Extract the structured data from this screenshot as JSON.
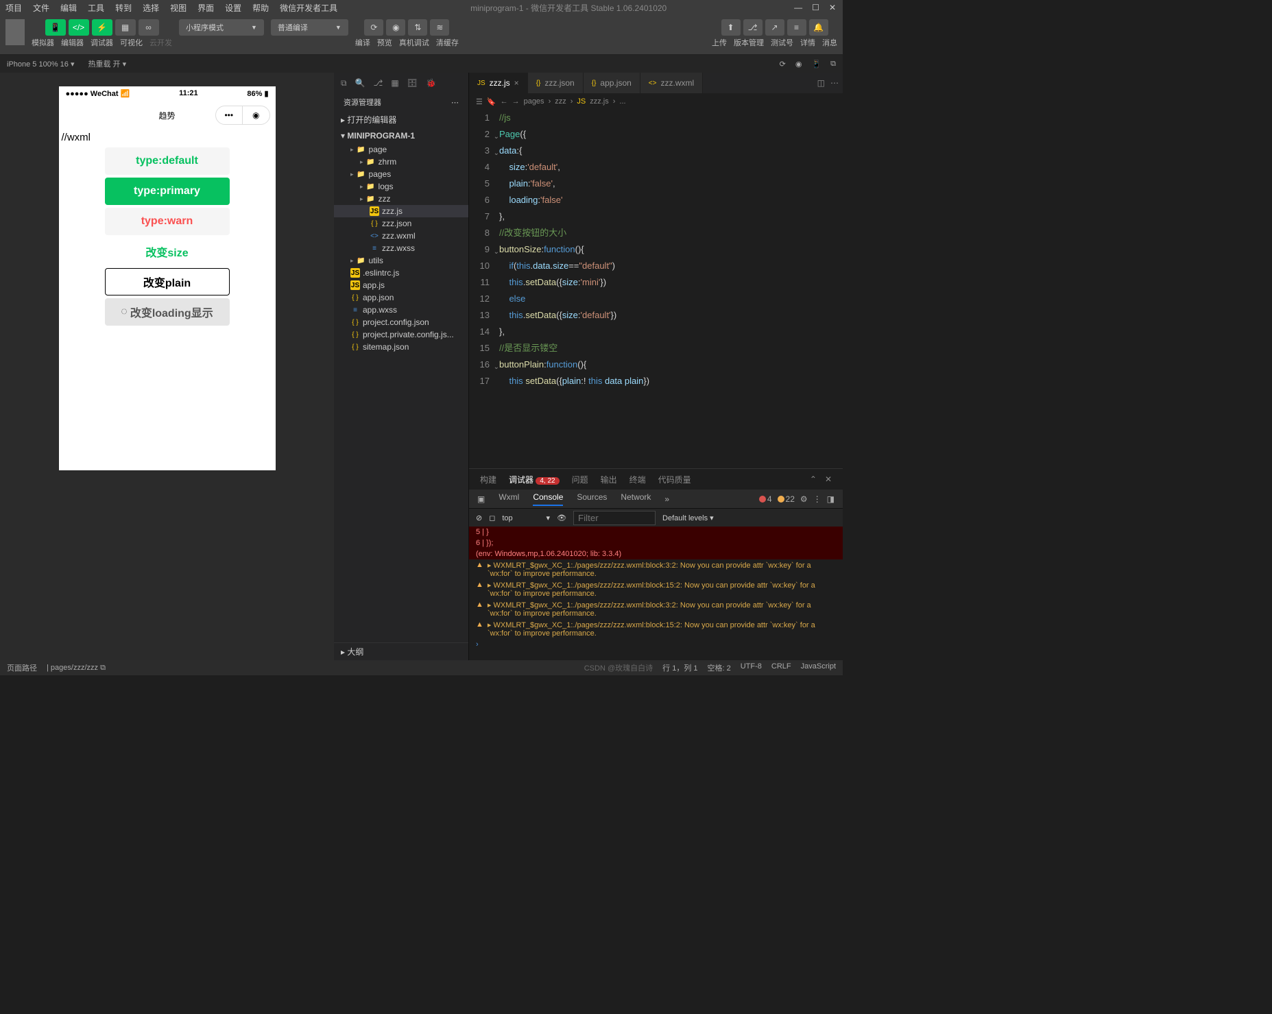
{
  "titlebar": {
    "menus": [
      "项目",
      "文件",
      "编辑",
      "工具",
      "转到",
      "选择",
      "视图",
      "界面",
      "设置",
      "帮助",
      "微信开发者工具"
    ],
    "title": "miniprogram-1 - 微信开发者工具 Stable 1.06.2401020"
  },
  "toolbar": {
    "groups": [
      {
        "labels": [
          "模拟器",
          "编辑器",
          "调试器",
          "可视化"
        ],
        "cloud": "云开发"
      }
    ],
    "mode": "小程序模式",
    "compile": "普通编译",
    "actions": [
      "编译",
      "预览",
      "真机调试",
      "清缓存"
    ],
    "right": [
      "上传",
      "版本管理",
      "测试号",
      "详情",
      "消息"
    ]
  },
  "subbar": {
    "device": "iPhone 5 100% 16",
    "hot": "热重载 开"
  },
  "phone": {
    "carrier": "●●●●● WeChat",
    "wifi": "📶",
    "time": "11:21",
    "battery": "86%",
    "title": "趋势",
    "wxml": "//wxml",
    "buttons": [
      "type:default",
      "type:primary",
      "type:warn",
      "改变size",
      "改变plain",
      "改变loading显示"
    ]
  },
  "explorer": {
    "title": "资源管理器",
    "sections": {
      "open": "打开的编辑器",
      "project": "MINIPROGRAM-1",
      "outline": "大纲"
    },
    "tree": [
      {
        "d": 1,
        "t": "folder",
        "n": "page"
      },
      {
        "d": 2,
        "t": "folder",
        "n": "zhrm"
      },
      {
        "d": 1,
        "t": "folder",
        "n": "pages"
      },
      {
        "d": 2,
        "t": "folder",
        "n": "logs"
      },
      {
        "d": 2,
        "t": "folder",
        "n": "zzz"
      },
      {
        "d": 3,
        "t": "js",
        "n": "zzz.js",
        "sel": true
      },
      {
        "d": 3,
        "t": "json",
        "n": "zzz.json"
      },
      {
        "d": 3,
        "t": "wxml",
        "n": "zzz.wxml"
      },
      {
        "d": 3,
        "t": "wxss",
        "n": "zzz.wxss"
      },
      {
        "d": 1,
        "t": "folder",
        "n": "utils"
      },
      {
        "d": 1,
        "t": "js",
        "n": ".eslintrc.js"
      },
      {
        "d": 1,
        "t": "js",
        "n": "app.js"
      },
      {
        "d": 1,
        "t": "json",
        "n": "app.json"
      },
      {
        "d": 1,
        "t": "wxss",
        "n": "app.wxss"
      },
      {
        "d": 1,
        "t": "json",
        "n": "project.config.json"
      },
      {
        "d": 1,
        "t": "json",
        "n": "project.private.config.js..."
      },
      {
        "d": 1,
        "t": "json",
        "n": "sitemap.json"
      }
    ]
  },
  "tabs": [
    {
      "icon": "JS",
      "name": "zzz.js",
      "active": true,
      "close": true
    },
    {
      "icon": "{}",
      "name": "zzz.json"
    },
    {
      "icon": "{}",
      "name": "app.json"
    },
    {
      "icon": "<>",
      "name": "zzz.wxml"
    }
  ],
  "breadcrumb": [
    "pages",
    "zzz",
    "zzz.js",
    "..."
  ],
  "code": {
    "lines": [
      {
        "n": 1,
        "seg": [
          [
            "c-comment",
            "//js"
          ]
        ]
      },
      {
        "n": 2,
        "fold": true,
        "seg": [
          [
            "c-page",
            "Page"
          ],
          [
            "c-punc",
            "("
          ],
          [
            "c-punc",
            "{"
          ]
        ]
      },
      {
        "n": 3,
        "fold": true,
        "seg": [
          [
            "c-prop",
            "data"
          ],
          [
            "c-punc",
            ":"
          ],
          [
            "c-punc",
            "{"
          ]
        ]
      },
      {
        "n": 4,
        "seg": [
          [
            "",
            "    "
          ],
          [
            "c-prop",
            "size"
          ],
          [
            "c-punc",
            ":"
          ],
          [
            "c-str",
            "'default'"
          ],
          [
            "c-punc",
            ","
          ]
        ]
      },
      {
        "n": 5,
        "seg": [
          [
            "",
            "    "
          ],
          [
            "c-prop",
            "plain"
          ],
          [
            "c-punc",
            ":"
          ],
          [
            "c-str",
            "'false'"
          ],
          [
            "c-punc",
            ","
          ]
        ]
      },
      {
        "n": 6,
        "seg": [
          [
            "",
            "    "
          ],
          [
            "c-prop",
            "loading"
          ],
          [
            "c-punc",
            ":"
          ],
          [
            "c-str",
            "'false'"
          ]
        ]
      },
      {
        "n": 7,
        "seg": [
          [
            "c-punc",
            "},"
          ]
        ]
      },
      {
        "n": 8,
        "seg": [
          [
            "c-comment",
            "//改变按钮的大小"
          ]
        ]
      },
      {
        "n": 9,
        "fold": true,
        "seg": [
          [
            "c-fn",
            "buttonSize"
          ],
          [
            "c-punc",
            ":"
          ],
          [
            "c-kw",
            "function"
          ],
          [
            "c-punc",
            "(){"
          ]
        ]
      },
      {
        "n": 10,
        "seg": [
          [
            "",
            "    "
          ],
          [
            "c-kw",
            "if"
          ],
          [
            "c-punc",
            "("
          ],
          [
            "c-this",
            "this"
          ],
          [
            "c-punc",
            "."
          ],
          [
            "c-prop",
            "data"
          ],
          [
            "c-punc",
            "."
          ],
          [
            "c-prop",
            "size"
          ],
          [
            "c-punc",
            "=="
          ],
          [
            "c-str",
            "\"default\""
          ],
          [
            "c-punc",
            ")"
          ]
        ]
      },
      {
        "n": 11,
        "seg": [
          [
            "",
            "    "
          ],
          [
            "c-this",
            "this"
          ],
          [
            "c-punc",
            "."
          ],
          [
            "c-fn",
            "setData"
          ],
          [
            "c-punc",
            "({"
          ],
          [
            "c-prop",
            "size"
          ],
          [
            "c-punc",
            ":"
          ],
          [
            "c-str",
            "'mini'"
          ],
          [
            "c-punc",
            "})"
          ]
        ]
      },
      {
        "n": 12,
        "seg": [
          [
            "",
            "    "
          ],
          [
            "c-kw",
            "else"
          ]
        ]
      },
      {
        "n": 13,
        "seg": [
          [
            "",
            "    "
          ],
          [
            "c-this",
            "this"
          ],
          [
            "c-punc",
            "."
          ],
          [
            "c-fn",
            "setData"
          ],
          [
            "c-punc",
            "({"
          ],
          [
            "c-prop",
            "size"
          ],
          [
            "c-punc",
            ":"
          ],
          [
            "c-str",
            "'default'"
          ],
          [
            "c-punc",
            "})"
          ]
        ]
      },
      {
        "n": 14,
        "seg": [
          [
            "c-punc",
            "},"
          ]
        ]
      },
      {
        "n": 15,
        "seg": [
          [
            "c-comment",
            "//是否显示镂空"
          ]
        ]
      },
      {
        "n": 16,
        "fold": true,
        "seg": [
          [
            "c-fn",
            "buttonPlain"
          ],
          [
            "c-punc",
            ":"
          ],
          [
            "c-kw",
            "function"
          ],
          [
            "c-punc",
            "(){"
          ]
        ]
      },
      {
        "n": 17,
        "seg": [
          [
            "",
            "    "
          ],
          [
            "c-this",
            "this"
          ],
          [
            "c-punc",
            " "
          ],
          [
            "c-fn",
            "setData"
          ],
          [
            "c-punc",
            "({"
          ],
          [
            "c-prop",
            "plain"
          ],
          [
            "c-punc",
            ":! "
          ],
          [
            "c-this",
            "this"
          ],
          [
            "c-punc",
            " "
          ],
          [
            "c-prop",
            "data"
          ],
          [
            "c-punc",
            " "
          ],
          [
            "c-prop",
            "plain"
          ],
          [
            "c-punc",
            "})"
          ]
        ]
      }
    ]
  },
  "panel": {
    "tabs": [
      "构建",
      "调试器",
      "问题",
      "输出",
      "终端",
      "代码质量"
    ],
    "active": "调试器",
    "badge": "4, 22",
    "devtabs": [
      "Wxml",
      "Console",
      "Sources",
      "Network"
    ],
    "devactive": "Console",
    "errn": "4",
    "warnn": "22",
    "top": "top",
    "filter": "Filter",
    "levels": "Default levels",
    "console": {
      "err": [
        "    5 | }",
        "    6 | });",
        "(env: Windows,mp,1.06.2401020; lib: 3.3.4)"
      ],
      "warns": [
        "WXMLRT_$gwx_XC_1:./pages/zzz/zzz.wxml:block:3:2: Now you can provide attr `wx:key` for a `wx:for` to improve performance.",
        "WXMLRT_$gwx_XC_1:./pages/zzz/zzz.wxml:block:15:2: Now you can provide attr `wx:key` for a `wx:for` to improve performance.",
        "WXMLRT_$gwx_XC_1:./pages/zzz/zzz.wxml:block:3:2: Now you can provide attr `wx:key` for a `wx:for` to improve performance.",
        "WXMLRT_$gwx_XC_1:./pages/zzz/zzz.wxml:block:15:2: Now you can provide attr `wx:key` for a `wx:for` to improve performance."
      ]
    }
  },
  "statusbar": {
    "left": [
      "页面路径",
      "pages/zzz/zzz"
    ],
    "right": [
      "行 1，列 1",
      "空格: 2",
      "UTF-8",
      "CRLF",
      "JavaScript"
    ],
    "watermark": "CSDN @玫瑰自白诗"
  }
}
